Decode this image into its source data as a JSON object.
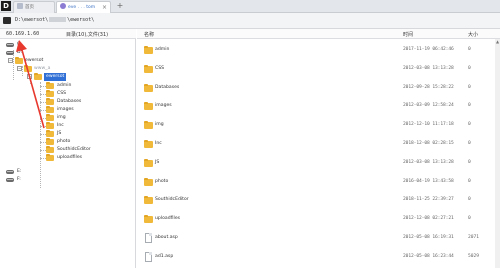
{
  "app": {
    "logo_letter": "D"
  },
  "tabs": [
    {
      "label": "首页"
    },
    {
      "label": "eve . . . tom",
      "close": "×"
    }
  ],
  "new_tab": "+",
  "address": {
    "path_prefix": "D:\\ewersot\\",
    "path_suffix": "\\ewersot\\"
  },
  "left_panel": {
    "ip": "60.169.1.60",
    "count": "目录(10),文件(31)",
    "tree": [
      {
        "label": "C:"
      },
      {
        "label": "D:"
      },
      {
        "label": "ewersot"
      },
      {
        "label": "www_a"
      },
      {
        "label": "ewersot"
      },
      {
        "label": "admin"
      },
      {
        "label": "CSS"
      },
      {
        "label": "Databases"
      },
      {
        "label": "images"
      },
      {
        "label": "img"
      },
      {
        "label": "Inc"
      },
      {
        "label": "JS"
      },
      {
        "label": "photo"
      },
      {
        "label": "SouthidcEditor"
      },
      {
        "label": "uploadfiles"
      },
      {
        "label": "E:"
      },
      {
        "label": "F:"
      }
    ]
  },
  "right_panel": {
    "headers": {
      "name": "名称",
      "time": "时间",
      "size": "大小"
    },
    "rows": [
      {
        "type": "folder",
        "name": "admin",
        "time": "2017-11-19 06:42:46",
        "size": "0"
      },
      {
        "type": "folder",
        "name": "CSS",
        "time": "2012-03-08 13:13:28",
        "size": "0"
      },
      {
        "type": "folder",
        "name": "Databases",
        "time": "2012-09-28 15:28:22",
        "size": "0"
      },
      {
        "type": "folder",
        "name": "images",
        "time": "2012-03-09 12:58:24",
        "size": "0"
      },
      {
        "type": "folder",
        "name": "img",
        "time": "2012-12-10 11:17:18",
        "size": "0"
      },
      {
        "type": "folder",
        "name": "Inc",
        "time": "2018-12-08 02:28:15",
        "size": "0"
      },
      {
        "type": "folder",
        "name": "JS",
        "time": "2012-03-08 13:13:28",
        "size": "0"
      },
      {
        "type": "folder",
        "name": "photo",
        "time": "2016-04-19 13:43:58",
        "size": "0"
      },
      {
        "type": "folder",
        "name": "SouthidcEditor",
        "time": "2018-11-25 22:39:27",
        "size": "0"
      },
      {
        "type": "folder",
        "name": "uploadfiles",
        "time": "2012-12-08 02:27:21",
        "size": "0"
      },
      {
        "type": "file",
        "name": "about.asp",
        "time": "2012-05-08 16:19:31",
        "size": "2071"
      },
      {
        "type": "file",
        "name": "ad1.asp",
        "time": "2012-05-08 16:23:44",
        "size": "5029"
      }
    ]
  },
  "colors": {
    "arrow": "#e8392f",
    "selection": "#2f6fd6",
    "folder": "#f1b93a"
  }
}
